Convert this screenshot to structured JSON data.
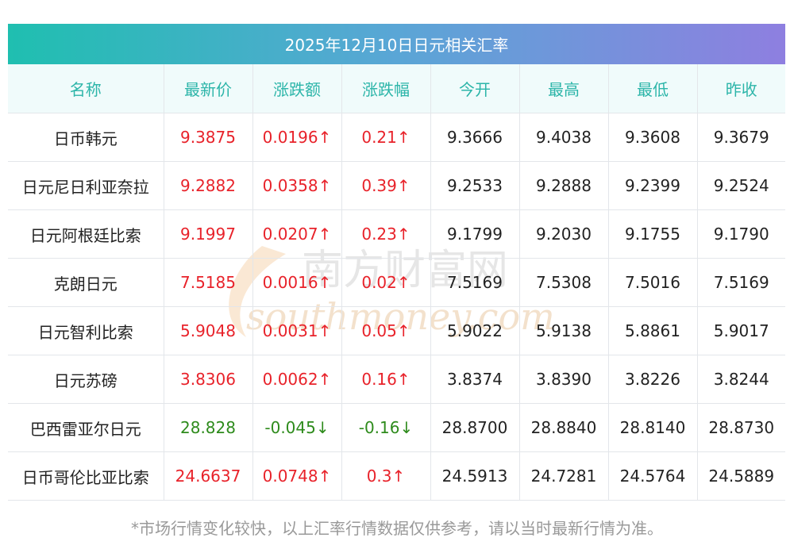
{
  "title": "2025年12月10日日元相关汇率",
  "headers": [
    "名称",
    "最新价",
    "涨跌额",
    "涨跌幅",
    "今开",
    "最高",
    "最低",
    "昨收"
  ],
  "rows": [
    {
      "name": "日币韩元",
      "latest": "9.3875",
      "change": "0.0196↑",
      "pct": "0.21↑",
      "open": "9.3666",
      "high": "9.4038",
      "low": "9.3608",
      "prev": "9.3679",
      "dir": "up"
    },
    {
      "name": "日元尼日利亚奈拉",
      "latest": "9.2882",
      "change": "0.0358↑",
      "pct": "0.39↑",
      "open": "9.2533",
      "high": "9.2888",
      "low": "9.2399",
      "prev": "9.2524",
      "dir": "up"
    },
    {
      "name": "日元阿根廷比索",
      "latest": "9.1997",
      "change": "0.0207↑",
      "pct": "0.23↑",
      "open": "9.1799",
      "high": "9.2030",
      "low": "9.1755",
      "prev": "9.1790",
      "dir": "up"
    },
    {
      "name": "克朗日元",
      "latest": "7.5185",
      "change": "0.0016↑",
      "pct": "0.02↑",
      "open": "7.5169",
      "high": "7.5308",
      "low": "7.5016",
      "prev": "7.5169",
      "dir": "up"
    },
    {
      "name": "日元智利比索",
      "latest": "5.9048",
      "change": "0.0031↑",
      "pct": "0.05↑",
      "open": "5.9022",
      "high": "5.9138",
      "low": "5.8861",
      "prev": "5.9017",
      "dir": "up"
    },
    {
      "name": "日元苏磅",
      "latest": "3.8306",
      "change": "0.0062↑",
      "pct": "0.16↑",
      "open": "3.8374",
      "high": "3.8390",
      "low": "3.8226",
      "prev": "3.8244",
      "dir": "up"
    },
    {
      "name": "巴西雷亚尔日元",
      "latest": "28.828",
      "change": "-0.045↓",
      "pct": "-0.16↓",
      "open": "28.8700",
      "high": "28.8840",
      "low": "28.8140",
      "prev": "28.8730",
      "dir": "down"
    },
    {
      "name": "日币哥伦比亚比索",
      "latest": "24.6637",
      "change": "0.0748↑",
      "pct": "0.3↑",
      "open": "24.5913",
      "high": "24.7281",
      "low": "24.5764",
      "prev": "24.5889",
      "dir": "up"
    }
  ],
  "footnote": "*市场行情变化较快，以上汇率行情数据仅供参考，请以当时最新行情为准。",
  "watermark": {
    "cn": "南方财富网",
    "en": "southmoney.com"
  },
  "colors": {
    "up": "#e8222a",
    "down": "#2e8b1c",
    "header_text": "#2cb5a9"
  }
}
